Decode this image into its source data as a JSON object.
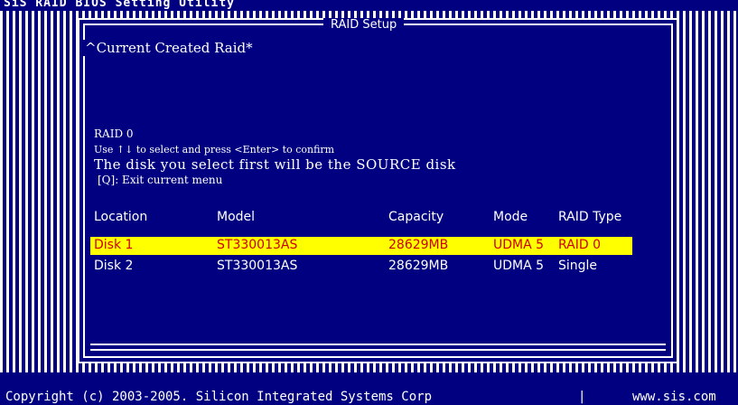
{
  "header": {
    "title": "SiS RAID BIOS Setting Utility"
  },
  "dialog": {
    "title": "RAID Setup",
    "current_raid": "Current Created Raid",
    "info": {
      "raid_label": "RAID 0",
      "hint": "Use ↑↓ to select and press <Enter> to confirm",
      "source": "The disk you select first will be the SOURCE disk",
      "exit": "[Q]: Exit current menu"
    },
    "table": {
      "headers": [
        "Location",
        "Model",
        "Capacity",
        "Mode",
        "RAID Type"
      ],
      "rows": [
        {
          "location": "Disk 1",
          "model": "ST330013AS",
          "capacity": "28629MB",
          "mode": "UDMA 5",
          "raid_type": "RAID 0",
          "selected": true
        },
        {
          "location": "Disk 2",
          "model": "ST330013AS",
          "capacity": "28629MB",
          "mode": "UDMA 5",
          "raid_type": "Single",
          "selected": false
        }
      ]
    }
  },
  "footer": {
    "copyright": "Copyright (c) 2003-2005. Silicon Integrated Systems Corp",
    "separator": "|",
    "website": "www.sis.com"
  },
  "colors": {
    "background": "#000080",
    "text": "#ffffff",
    "highlight_bg": "#ffff00",
    "highlight_text": "#cc0000"
  }
}
